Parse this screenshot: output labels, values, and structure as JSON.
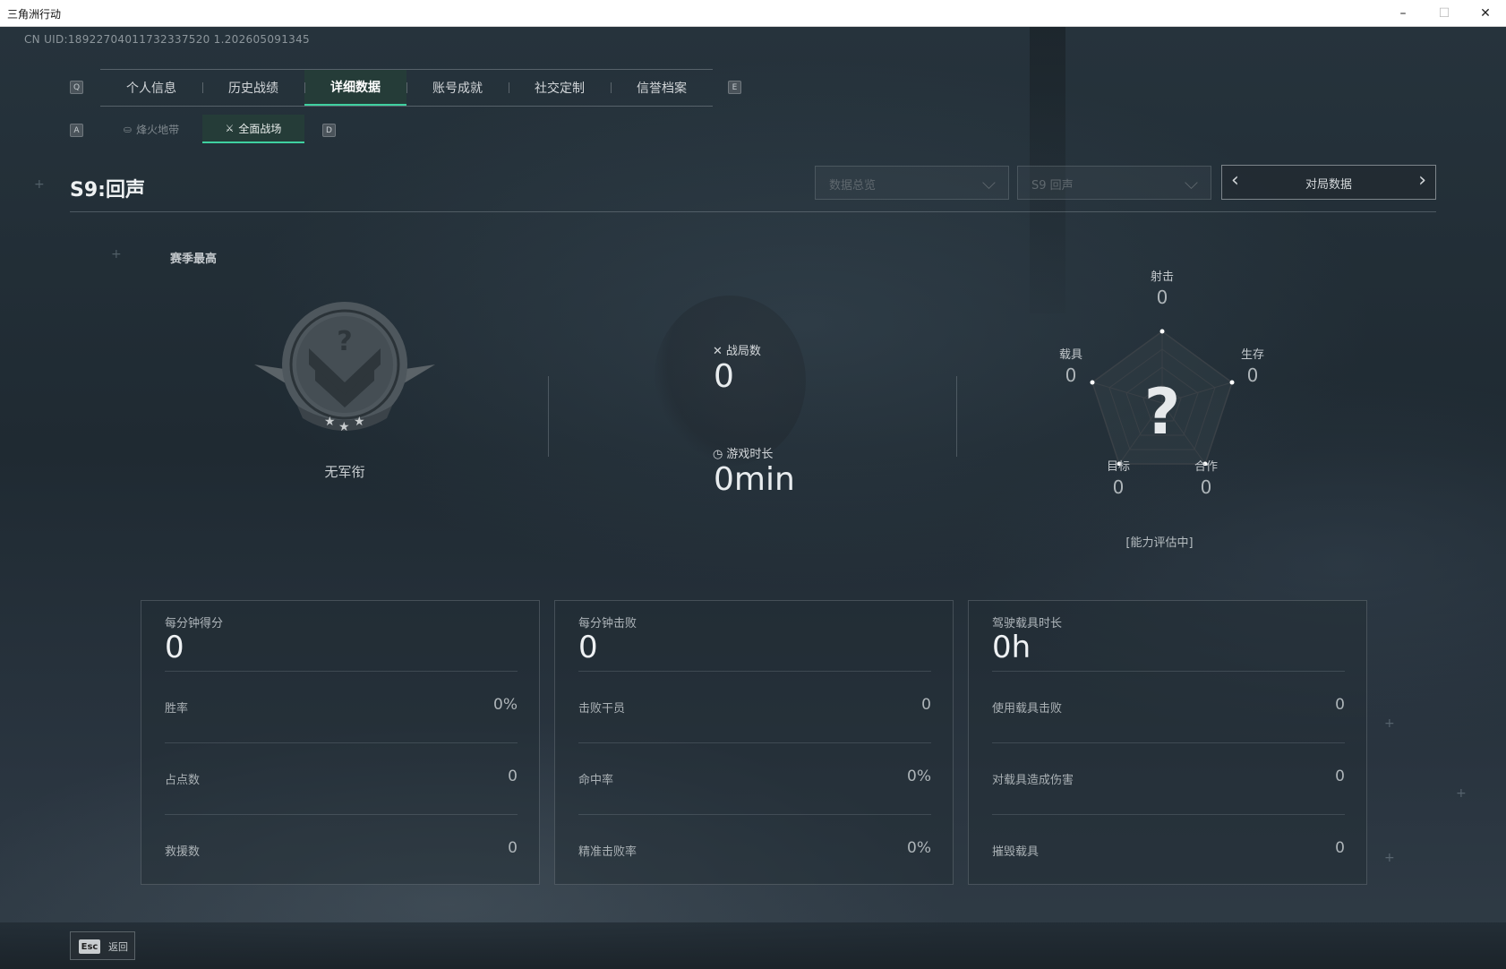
{
  "window": {
    "title": "三角洲行动",
    "min": "–",
    "max": "☐",
    "close": "✕"
  },
  "uid": "CN UID:18922704011732337520 1.202605091345",
  "tabs": {
    "left_key": "Q",
    "right_key": "E",
    "items": [
      "个人信息",
      "历史战绩",
      "详细数据",
      "账号成就",
      "社交定制",
      "信誉档案"
    ],
    "active": 2
  },
  "subtabs": {
    "left_key": "A",
    "right_key": "D",
    "items": [
      "烽火地带",
      "全面战场"
    ],
    "active": 1
  },
  "season_title": "S9:回声",
  "filters": {
    "data_view": "数据总览",
    "season": "S9 回声",
    "pager_label": "对局数据"
  },
  "rank": {
    "section_label": "赛季最高",
    "name": "无军衔"
  },
  "battles": {
    "label": "战局数",
    "value": "0"
  },
  "playtime": {
    "label": "游戏时长",
    "value": "0min"
  },
  "radar": {
    "center": "?",
    "axes": [
      {
        "label": "射击",
        "value": "0"
      },
      {
        "label": "生存",
        "value": "0"
      },
      {
        "label": "合作",
        "value": "0"
      },
      {
        "label": "目标",
        "value": "0"
      },
      {
        "label": "载具",
        "value": "0"
      }
    ],
    "status": "[能力评估中]"
  },
  "cards": [
    {
      "head_label": "每分钟得分",
      "head_value": "0",
      "rows": [
        {
          "label": "胜率",
          "value": "0%"
        },
        {
          "label": "占点数",
          "value": "0"
        },
        {
          "label": "救援数",
          "value": "0"
        }
      ]
    },
    {
      "head_label": "每分钟击败",
      "head_value": "0",
      "rows": [
        {
          "label": "击败干员",
          "value": "0"
        },
        {
          "label": "命中率",
          "value": "0%"
        },
        {
          "label": "精准击败率",
          "value": "0%"
        }
      ]
    },
    {
      "head_label": "驾驶载具时长",
      "head_value": "0h",
      "rows": [
        {
          "label": "使用载具击败",
          "value": "0"
        },
        {
          "label": "对载具造成伤害",
          "value": "0"
        },
        {
          "label": "摧毁载具",
          "value": "0"
        }
      ]
    }
  ],
  "footer": {
    "esc_key": "Esc",
    "back_label": "返回"
  },
  "colors": {
    "accent": "#3fd0a0",
    "tab_active_bg": "#263e38"
  }
}
